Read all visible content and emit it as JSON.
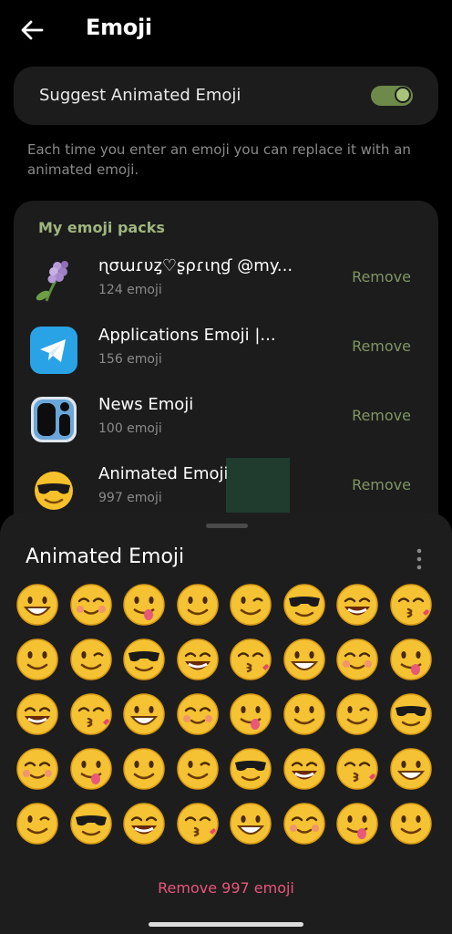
{
  "header": {
    "title": "Emoji"
  },
  "suggest": {
    "label": "Suggest Animated Emoji",
    "enabled": true
  },
  "help_text": "Each time you enter an emoji you can replace it with an animated emoji.",
  "packs": {
    "header": "My emoji packs",
    "items": [
      {
        "name": "ɳσɯɾυȥ♡ʂρɾιɳɠ @my...",
        "count": "124 emoji",
        "remove": "Remove",
        "icon": "lilac-flower-icon"
      },
      {
        "name": "Applications Emoji |...",
        "count": "156 emoji",
        "remove": "Remove",
        "icon": "telegram-icon"
      },
      {
        "name": "News Emoji",
        "count": "100 emoji",
        "remove": "Remove",
        "icon": "news-emoji-icon"
      },
      {
        "name": "Animated Emoji",
        "count": "997 emoji",
        "remove": "Remove",
        "icon": "sunglasses-face-icon"
      }
    ]
  },
  "sheet": {
    "title": "Animated Emoji",
    "remove_all": "Remove 997 emoji"
  },
  "colors": {
    "accent_green": "#9fb67e",
    "remove_pink": "#e8567a",
    "toggle_on": "#6e8a4a"
  }
}
